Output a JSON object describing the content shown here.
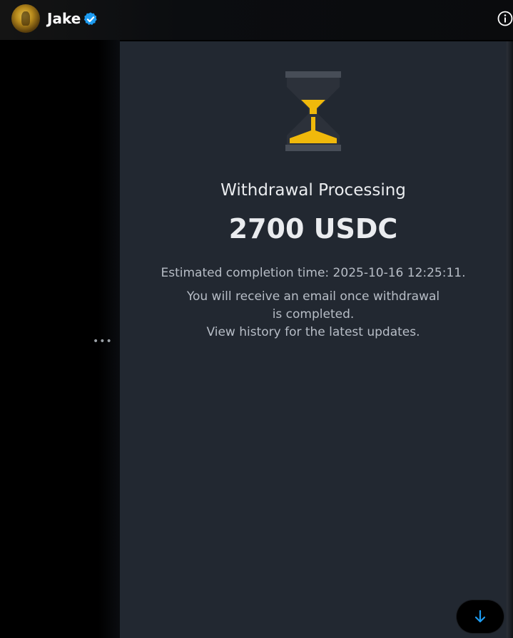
{
  "header": {
    "username": "Jake",
    "verified_icon": "verified-badge-icon",
    "info_icon": "info-icon"
  },
  "sidebar": {
    "more_label": "•••"
  },
  "withdrawal": {
    "status_icon": "hourglass-icon",
    "title": "Withdrawal Processing",
    "amount": "2700 USDC",
    "estimated_completion": "Estimated completion time: 2025-10-16 12:25:11.",
    "message_line1": "You will receive an email once withdrawal",
    "message_line2": "is completed.",
    "message_line3": "View history for the latest updates."
  },
  "scroll_button": {
    "icon": "arrow-down-icon"
  },
  "colors": {
    "panel_bg": "#222831",
    "accent_yellow": "#f0b90b",
    "verified_blue": "#1d9bf0",
    "scroll_arrow": "#1d9bf0",
    "text_primary": "#eaecef",
    "text_secondary": "#b7bdc6"
  }
}
